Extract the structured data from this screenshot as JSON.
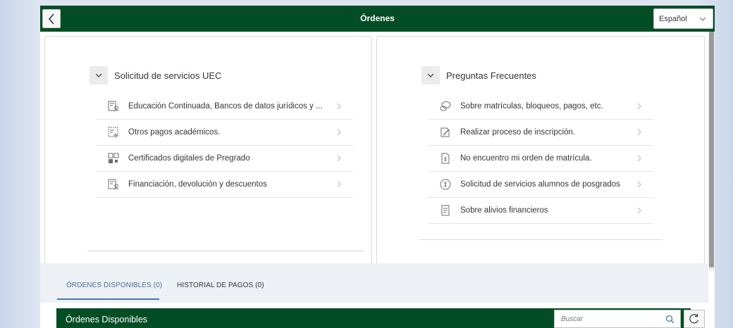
{
  "shell": {
    "title": "Órdenes",
    "language": "Español"
  },
  "left_group": {
    "title": "Solicitud de servicios UEC",
    "items": [
      {
        "label": "Educación Continuada, Bancos de datos jurídicos y ...",
        "icon": "document-person-icon"
      },
      {
        "label": "Otros pagos académicos.",
        "icon": "form-add-icon"
      },
      {
        "label": "Certificados digitales de Pregrado",
        "icon": "qr-code-icon"
      },
      {
        "label": "Financiación, devolución y descuentos",
        "icon": "document-person-icon"
      }
    ]
  },
  "right_group": {
    "title": "Preguntas Frecuentes",
    "items": [
      {
        "label": "Sobre matrículas, bloqueos, pagos, etc.",
        "icon": "chat-bubbles-icon"
      },
      {
        "label": "Realizar proceso de inscripción.",
        "icon": "edit-document-icon"
      },
      {
        "label": "No encuentro mi orden de matrícula.",
        "icon": "document-currency-icon"
      },
      {
        "label": "Solicitud de servicios alumnos de posgrados",
        "icon": "money-hand-icon"
      },
      {
        "label": "Sobre alivios financieros",
        "icon": "document-list-icon"
      }
    ]
  },
  "tabs": {
    "available": "ÓRDENES DISPONIBLES (0)",
    "history": "HISTORIAL DE PAGOS (0)"
  },
  "table": {
    "title": "Órdenes Disponibles",
    "search_placeholder": "Buscar"
  },
  "colors": {
    "brand_green": "#024d24",
    "tab_accent": "#4b78a8"
  }
}
